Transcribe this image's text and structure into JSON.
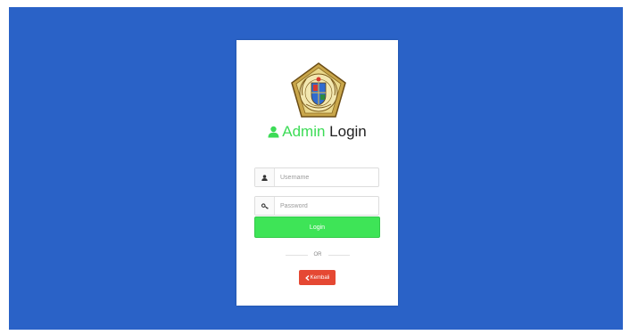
{
  "page": {
    "background_color": "#2a62c7",
    "card_color": "#ffffff"
  },
  "logo": {
    "icon": "university-seal-icon"
  },
  "title": {
    "icon": "user-icon",
    "admin_text": "Admin",
    "login_text": "Login",
    "accent_color": "#3ddc57"
  },
  "form": {
    "username": {
      "icon": "user-icon",
      "placeholder": "Username",
      "value": ""
    },
    "password": {
      "icon": "key-icon",
      "placeholder": "Password",
      "value": ""
    },
    "login_button": {
      "label": "Login",
      "color": "#3ee457"
    },
    "separator_text": "OR",
    "back_button": {
      "icon": "chevron-left-icon",
      "label": "Kembali",
      "color": "#e54833"
    }
  }
}
